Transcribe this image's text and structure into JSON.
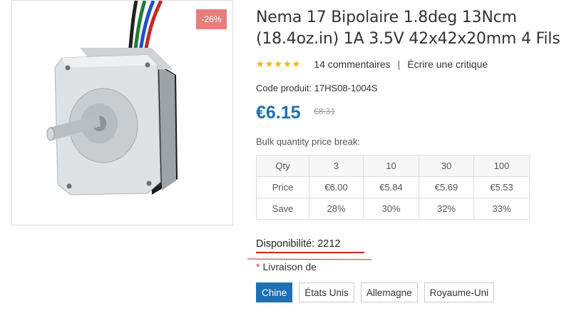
{
  "product": {
    "discount_badge": "-26%",
    "title": "Nema 17 Bipolaire 1.8deg 13Ncm (18.4oz.in) 1A 3.5V 42x42x20mm 4 Fils",
    "rating_stars": 5,
    "reviews_text": "14 commentaires",
    "separator": "|",
    "write_review": "Écrire une critique",
    "code_label": "Code produit:",
    "code_value": "17HS08-1004S",
    "price": "€6.15",
    "old_price": "€8.31",
    "bulk_label": "Bulk quantity price break:",
    "bulk_table": {
      "rows": [
        [
          "Qty",
          "3",
          "10",
          "30",
          "100"
        ],
        [
          "Price",
          "€6.00",
          "€5.84",
          "€5.69",
          "€5.53"
        ],
        [
          "Save",
          "28%",
          "30%",
          "32%",
          "33%"
        ]
      ]
    },
    "availability": "Disponibilité: 2212",
    "shipping_required": "*",
    "shipping_label": "Livraison de",
    "countries": [
      "Chine",
      "États Unis",
      "Allemagne",
      "Royaume-Uni"
    ],
    "selected_country": "Chine"
  },
  "colors": {
    "accent": "#1f6fb2",
    "badge": "#e67e7e",
    "star": "#f5b400",
    "annotation_red": "#c62828"
  },
  "icons": [
    "star-icon",
    "stepper-motor-image"
  ]
}
